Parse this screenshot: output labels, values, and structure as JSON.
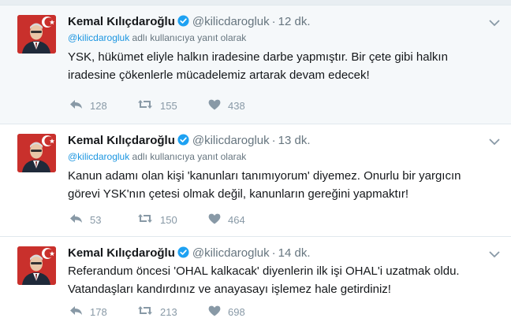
{
  "tweets": [
    {
      "name": "Kemal Kılıçdaroğlu",
      "handle": "@kilicdarogluk",
      "time": "12 dk.",
      "reply_handle": "@kilicdarogluk",
      "reply_suffix": " adlı kullanıcıya yanıt olarak",
      "text": "YSK, hükümet eliyle halkın iradesine darbe yapmıştır. Bir çete gibi halkın iradesine çökenlerle mücadelemiz artarak devam edecek!",
      "replies": "128",
      "retweets": "155",
      "likes": "438"
    },
    {
      "name": "Kemal Kılıçdaroğlu",
      "handle": "@kilicdarogluk",
      "time": "13 dk.",
      "reply_handle": "@kilicdarogluk",
      "reply_suffix": " adlı kullanıcıya yanıt olarak",
      "text": "Kanun adamı olan kişi 'kanunları tanımıyorum' diyemez. Onurlu bir yargıcın görevi YSK'nın çetesi olmak değil, kanunların gereğini yapmaktır!",
      "replies": "53",
      "retweets": "150",
      "likes": "464"
    },
    {
      "name": "Kemal Kılıçdaroğlu",
      "handle": "@kilicdarogluk",
      "time": "14 dk.",
      "text": "Referandum öncesi 'OHAL kalkacak' diyenlerin ilk işi OHAL'i uzatmak oldu. Vatandaşları kandırdınız ve anayasayı işlemez hale getirdiniz!",
      "replies": "178",
      "retweets": "213",
      "likes": "698"
    }
  ],
  "icons": {
    "verified": "verified-badge-icon",
    "caret": "chevron-down-icon",
    "reply": "reply-icon",
    "retweet": "retweet-icon",
    "like": "heart-icon"
  },
  "colors": {
    "link": "#1b95e0",
    "muted": "#66757f",
    "action": "#8899a6",
    "flag": "#c9302c"
  }
}
